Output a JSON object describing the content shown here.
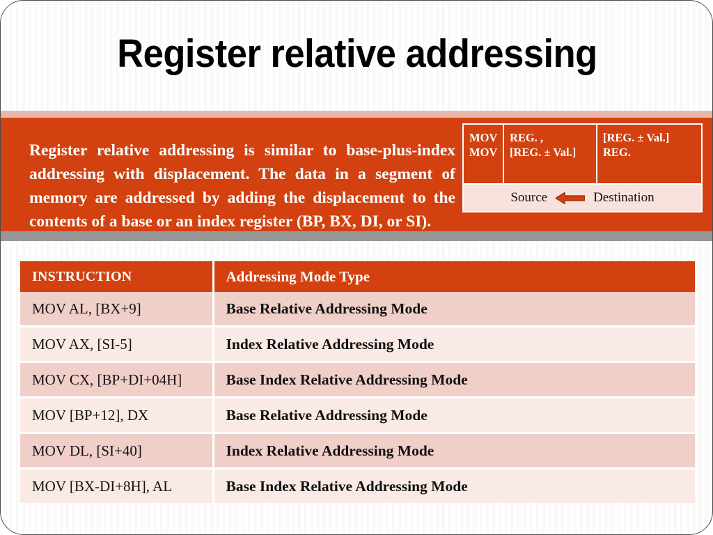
{
  "slide": {
    "title": "Register relative addressing",
    "colors": {
      "accent_orange": "#d2410f",
      "band_pink": "#e9b6aa",
      "band_gray": "#979797",
      "row_dark": "#f0cfc9",
      "row_light": "#faeae6",
      "footer_pink": "#f7e2de",
      "text_white": "#ffffff",
      "text_dark": "#111111"
    }
  },
  "body": {
    "paragraph": "Register relative addressing is similar to base-plus-index addressing with displacement. The data in a segment of memory are addressed by adding the displacement to the contents of a base or an index register (BP, BX, DI, or SI)."
  },
  "syntax_diagram": {
    "operation": {
      "line1": "MOV",
      "line2": "MOV"
    },
    "source_column": {
      "line1": "REG. ,",
      "line2": "[REG. ± Val.]"
    },
    "destination_column": {
      "line1": "[REG. ± Val.]",
      "line2": "REG."
    },
    "footer": {
      "source_label": "Source",
      "arrow_icon": "arrow-left-icon",
      "destination_label": "Destination"
    }
  },
  "modes_table": {
    "headers": {
      "instruction": "INSTRUCTION",
      "mode_type": "Addressing Mode Type"
    },
    "rows": [
      {
        "instruction": "MOV AL, [BX+9]",
        "mode": "Base Relative Addressing Mode"
      },
      {
        "instruction": "MOV AX, [SI-5]",
        "mode": "Index Relative Addressing Mode"
      },
      {
        "instruction": "MOV CX, [BP+DI+04H]",
        "mode": "Base Index Relative Addressing Mode"
      },
      {
        "instruction": "MOV [BP+12], DX",
        "mode": "Base Relative Addressing Mode"
      },
      {
        "instruction": "MOV DL, [SI+40]",
        "mode": "Index Relative Addressing Mode"
      },
      {
        "instruction": "MOV [BX-DI+8H], AL",
        "mode": "Base Index Relative Addressing Mode"
      }
    ]
  }
}
